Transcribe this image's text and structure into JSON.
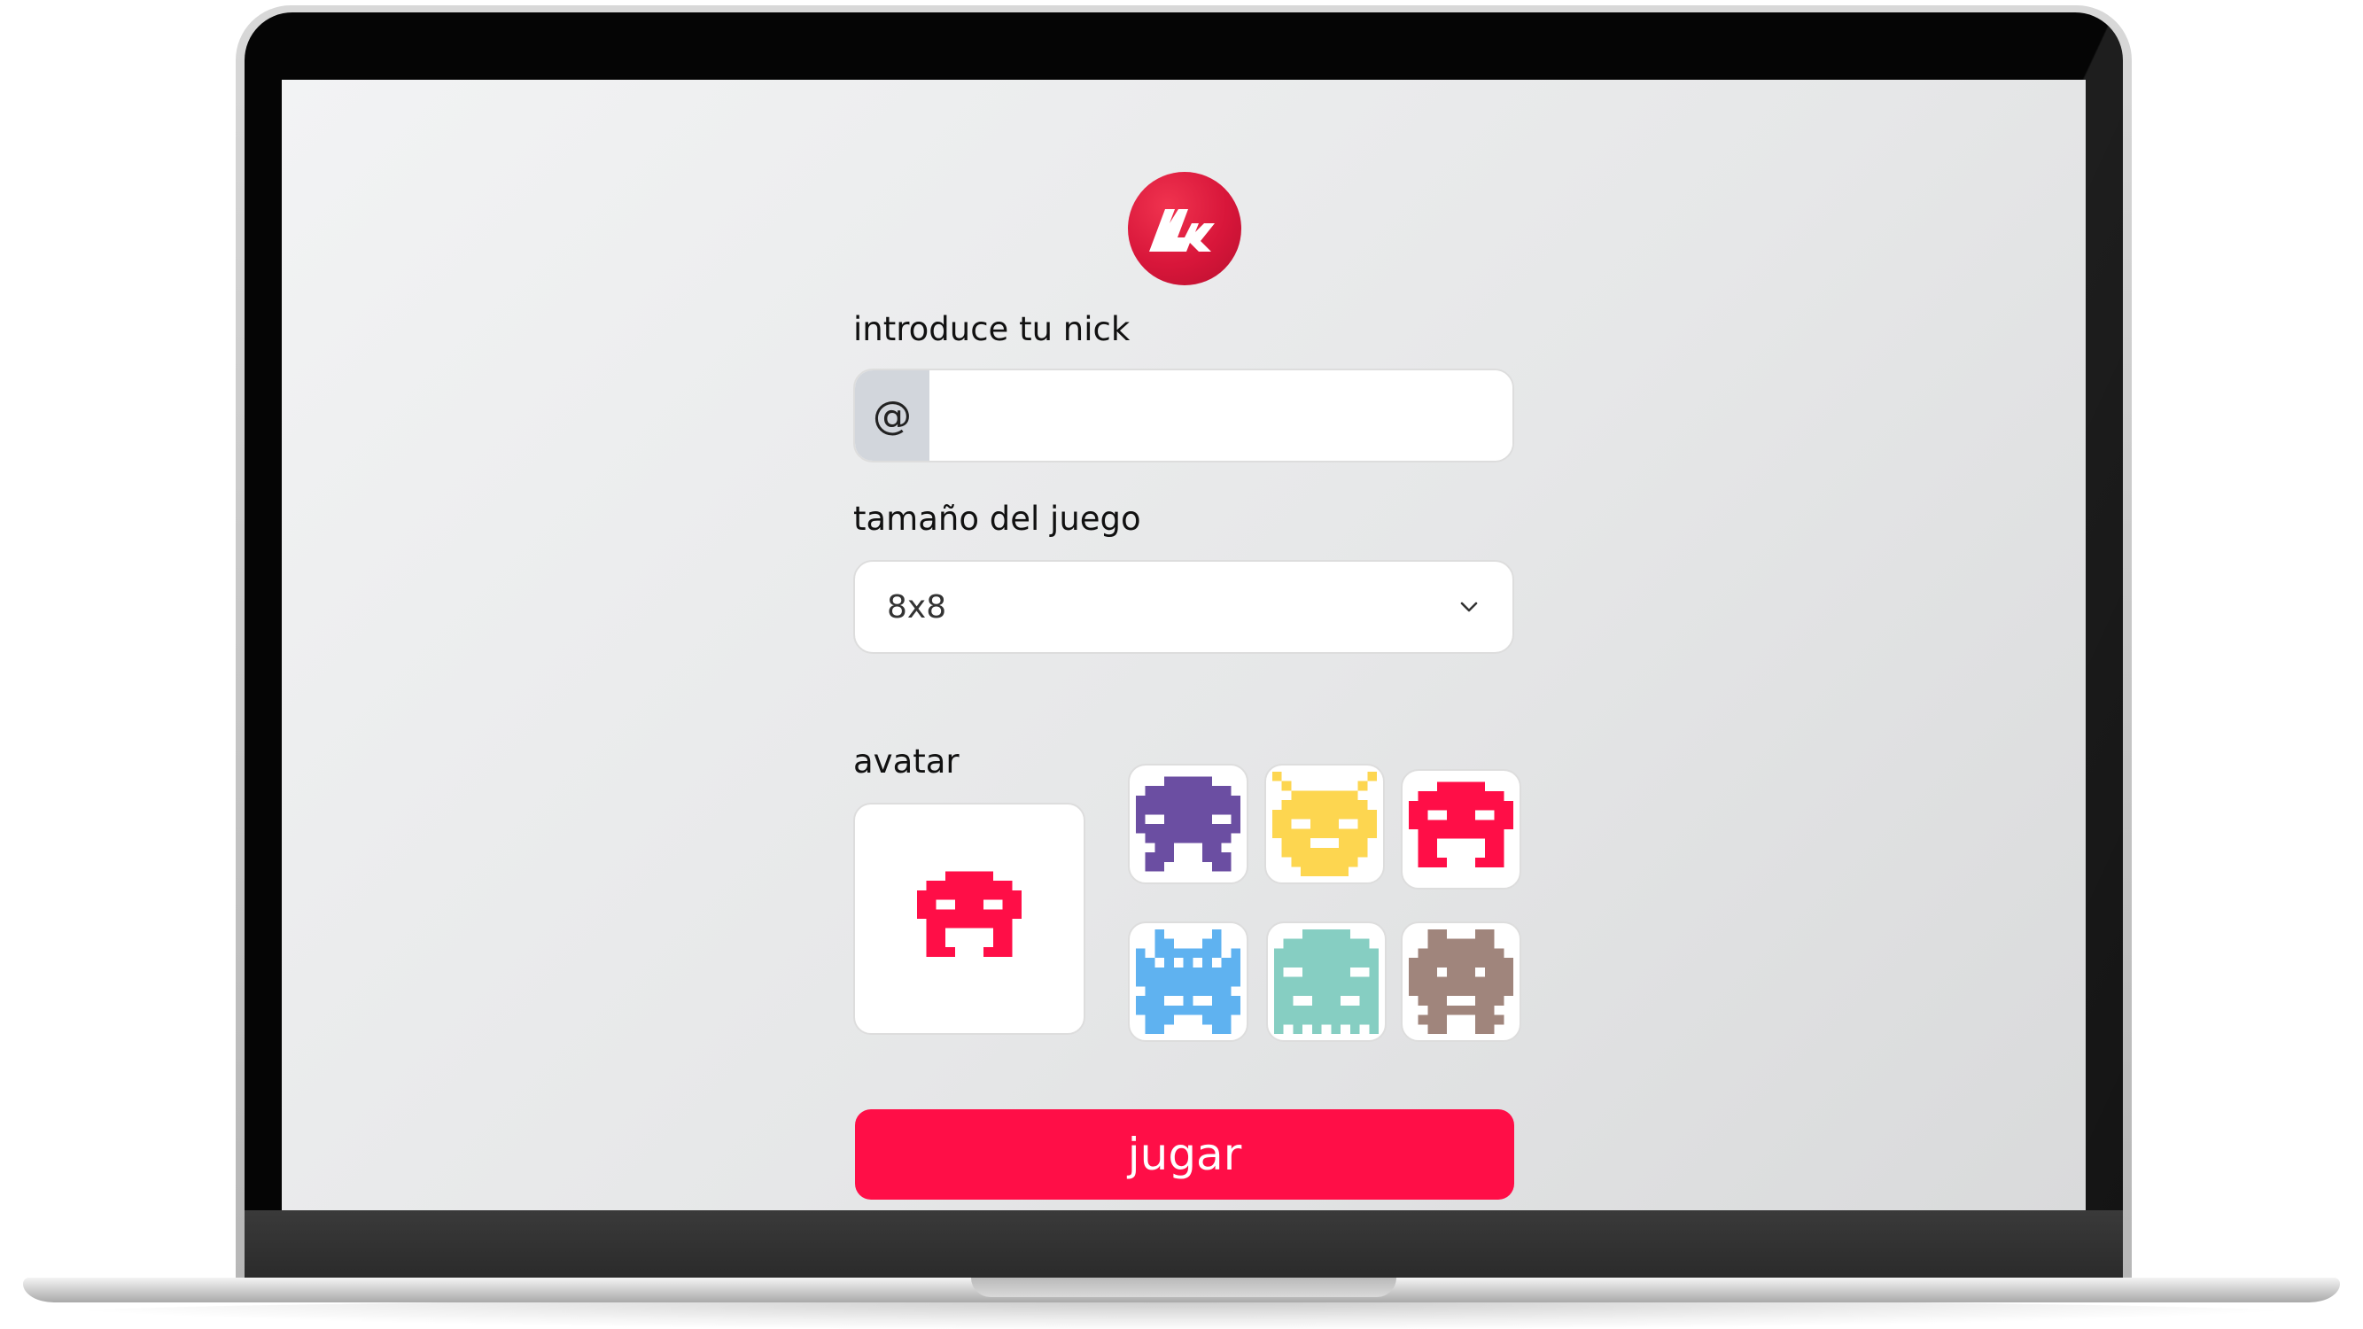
{
  "form": {
    "nick_label": "introduce tu nick",
    "nick_prefix": "@",
    "nick_value": "",
    "size_label": "tamaño del juego",
    "size_value": "8x8",
    "avatar_label": "avatar",
    "play_label": "jugar"
  },
  "colors": {
    "accent": "#ff0e47",
    "logo": "#d8163a",
    "screen_bg": "#e8e9ea"
  },
  "icons": {
    "logo": "mk-logo-icon",
    "select": "chevron-down-icon"
  },
  "avatars": {
    "selected": {
      "name": "red-invader",
      "color": "#ff0e47"
    },
    "options": [
      {
        "name": "purple-invader",
        "color": "#6b4ea2"
      },
      {
        "name": "yellow-bug",
        "color": "#fdd650"
      },
      {
        "name": "red-invader",
        "color": "#ff0e47"
      },
      {
        "name": "blue-invader",
        "color": "#5fb2f0"
      },
      {
        "name": "teal-ghost",
        "color": "#86cec2"
      },
      {
        "name": "brown-invader",
        "color": "#a0857c"
      }
    ]
  }
}
